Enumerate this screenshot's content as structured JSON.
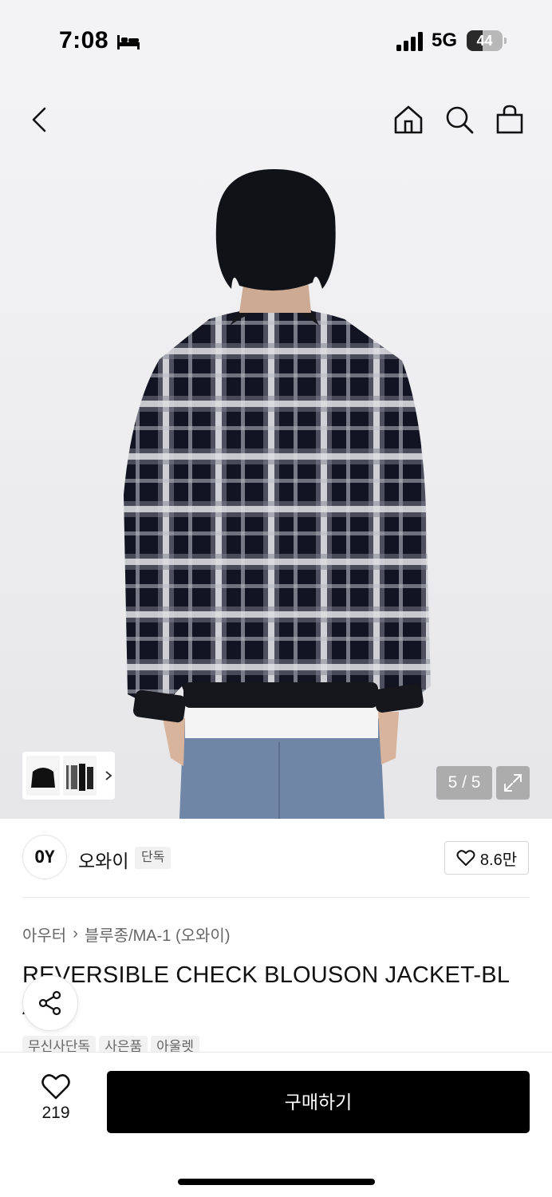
{
  "status_bar": {
    "time": "7:08",
    "focus_icon": "bed-icon",
    "network": "5G",
    "battery_level": "44",
    "battery_fraction": 0.44
  },
  "nav": {
    "back_icon": "chevron-left-icon",
    "home_icon": "home-icon",
    "search_icon": "search-icon",
    "cart_icon": "shopping-bag-icon"
  },
  "gallery": {
    "counter": "5 / 5",
    "expand_icon": "expand-icon",
    "thumbnail_arrow_icon": "chevron-right-icon"
  },
  "brand": {
    "logo_text": "OY",
    "name": "오와이",
    "badge": "단독",
    "likes": "8.6만"
  },
  "breadcrumb": {
    "category": "아우터",
    "subcategory": "블루종/MA-1 (오와이)"
  },
  "product": {
    "title_line1": "REVERSIBLE CHECK BLOUSON JACKET-BL",
    "title_line2": "A"
  },
  "tags": [
    "무신사단독",
    "사은품",
    "아울렛"
  ],
  "bottom_bar": {
    "wish_count": "219",
    "buy_label": "구매하기"
  },
  "colors": {
    "primary_button": "#000000",
    "background": "#ffffff",
    "tag_bg": "#f1f1f1"
  }
}
